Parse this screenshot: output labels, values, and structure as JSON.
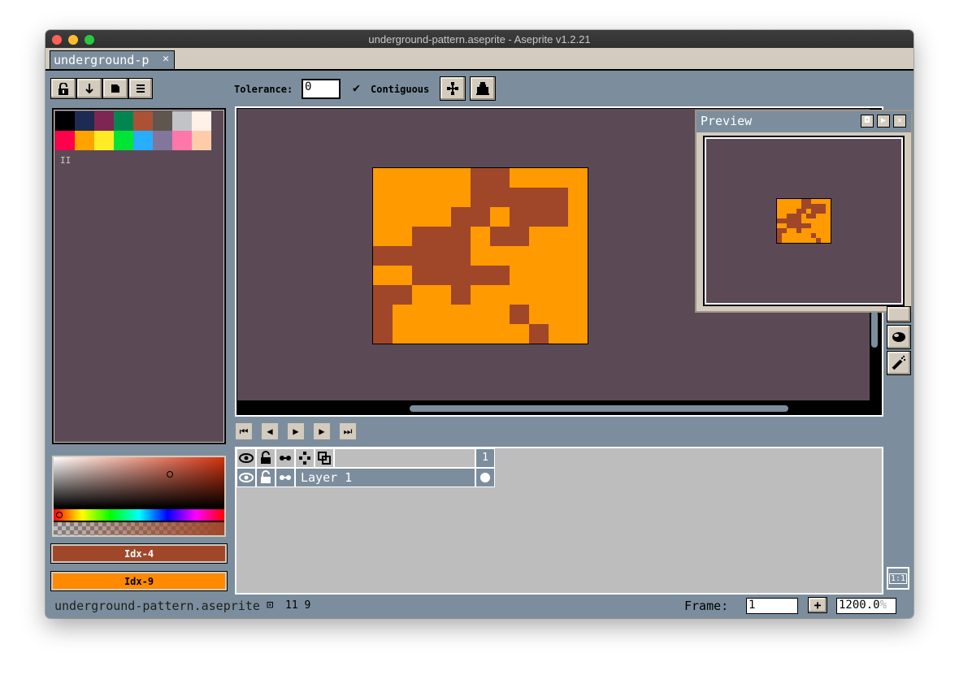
{
  "window": {
    "title": "underground-pattern.aseprite - Aseprite v1.2.21"
  },
  "tabs": [
    {
      "label": "underground-p",
      "close": "✕"
    }
  ],
  "toolbar": {
    "tolerance_label": "Tolerance:",
    "tolerance_value": "0",
    "contiguous_label": "Contiguous",
    "contiguous_checked": true
  },
  "palette": {
    "colors": [
      "#000000",
      "#1d2b53",
      "#7e2553",
      "#008751",
      "#ab5236",
      "#5f574f",
      "#c2c3c7",
      "#fff1e8",
      "#ff004d",
      "#ffa300",
      "#ffec27",
      "#00e436",
      "#29adff",
      "#83769c",
      "#ff77a8",
      "#ffccaa"
    ],
    "menu_label": "II"
  },
  "color_bar": {
    "foreground": {
      "label": "Idx-4",
      "color": "#a0472a"
    },
    "background": {
      "label": "Idx-9",
      "color": "#ff8a00"
    }
  },
  "sprite": {
    "width": 11,
    "height": 9,
    "base_color": "#ff9a00",
    "pattern_color": "#a0472a"
  },
  "preview": {
    "title": "Preview"
  },
  "timeline": {
    "frame_header": "1",
    "layers": [
      {
        "name": "Layer 1",
        "cel": true
      }
    ]
  },
  "status": {
    "filename": "underground-pattern.aseprite",
    "sprite_size": "11 9",
    "frame_label": "Frame:",
    "frame_value": "1",
    "zoom_value": "1200.0",
    "zoom_unit": "%"
  },
  "zoom_reset_label": "1:1",
  "icons": {
    "lock": "lock-icon",
    "down": "arrow-down-icon",
    "square": "square-icon",
    "menu": "hamburger-icon",
    "eye": "eye-icon",
    "link": "link-icon",
    "onion": "onion-skin-icon",
    "tree": "tree-icon",
    "paint": "paint-bucket-icon",
    "jumble": "jumble-icon",
    "spray": "spray-icon"
  }
}
